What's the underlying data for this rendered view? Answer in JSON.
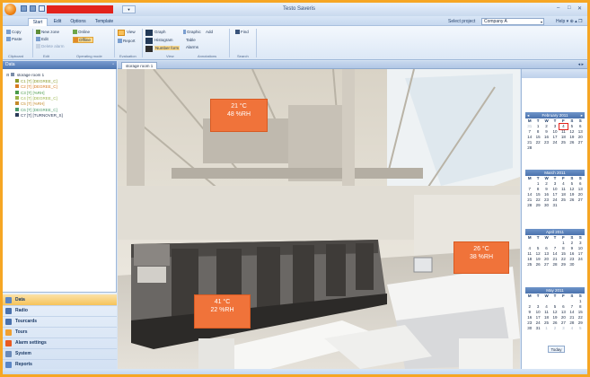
{
  "window": {
    "title": "Testo Saveris",
    "minimize_glyph": "–",
    "maximize_glyph": "□",
    "close_glyph": "✕",
    "qat_tab_label": "▼"
  },
  "ribbon_tabs": [
    "Start",
    "Edit",
    "Options",
    "Template"
  ],
  "project": {
    "label": "Select project",
    "value": "Company A",
    "arrow": "▾",
    "help": "Help ▾  ⊕ ▴ ❐"
  },
  "ribbon": {
    "clipboard": {
      "copy": "Copy",
      "paste": "Paste",
      "group": "Clipboard"
    },
    "edit": {
      "new_zone": "New zone",
      "edit": "Edit",
      "delete_alarm": "Delete alarm",
      "group": "Edit"
    },
    "operating_mode": {
      "online": "Online",
      "offline": "Offline",
      "group": "Operating mode"
    },
    "evaluation": {
      "view": "View",
      "report": "Report",
      "group": "Evaluation"
    },
    "view": {
      "graph": "Graph",
      "histogram": "Histogram",
      "number_form": "Number form",
      "group": "View"
    },
    "annotations": {
      "graphic": "Graphic",
      "table": "Table",
      "alarms": "Alarms",
      "add": "Add",
      "group": "Annotations"
    },
    "search": {
      "find": "Find",
      "group": "Search"
    }
  },
  "left_panel": {
    "title": "Data",
    "pin": "▫",
    "tree": {
      "root": "storage room 1",
      "children": [
        {
          "label": "C1 [T] [DEGREE_C]",
          "color": "#8a9a2a"
        },
        {
          "label": "C2 [T] [DEGREE_C]",
          "color": "#d97a20"
        },
        {
          "label": "C3 [T] [%RH]",
          "color": "#4a9a4a"
        },
        {
          "label": "C4 [T] [DEGREE_C]",
          "color": "#9ab44a"
        },
        {
          "label": "C5 [T] [%RH]",
          "color": "#c48a2a"
        },
        {
          "label": "C6 [T] [DEGREE_C]",
          "color": "#4a9a6a"
        },
        {
          "label": "C7 [T] [TURNOVER_S]",
          "color": "#2a3a58"
        }
      ]
    }
  },
  "nav": [
    {
      "label": "Data",
      "icon": "data-icon",
      "color": "#5b86c5",
      "active": true
    },
    {
      "label": "Radio",
      "icon": "radio-icon",
      "color": "#4a72ad"
    },
    {
      "label": "Tourcards",
      "icon": "tourcards-icon",
      "color": "#4a72ad"
    },
    {
      "label": "Tours",
      "icon": "tours-icon",
      "color": "#f0a030"
    },
    {
      "label": "Alarm settings",
      "icon": "alarm-icon",
      "color": "#e85a20"
    },
    {
      "label": "System",
      "icon": "system-icon",
      "color": "#6a8ab8"
    },
    {
      "label": "Reports",
      "icon": "reports-icon",
      "color": "#5b86c5"
    }
  ],
  "view_tab": {
    "label": "storage room 1",
    "close": "◂ ▸"
  },
  "readouts": [
    {
      "temp": "21 °C",
      "rh": "48 %RH"
    },
    {
      "temp": "26 °C",
      "rh": "38 %RH"
    },
    {
      "temp": "41 °C",
      "rh": "22 %RH"
    }
  ],
  "calendar": {
    "day_names": [
      "M",
      "T",
      "W",
      "T",
      "F",
      "S",
      "S"
    ],
    "today_label": "Today",
    "months": [
      {
        "title": "February 2011",
        "prev": "◂",
        "next": "▸",
        "days": [
          "31",
          "1",
          "2",
          "3",
          "4",
          "5",
          "6",
          "7",
          "8",
          "9",
          "10",
          "11",
          "12",
          "13",
          "14",
          "15",
          "16",
          "17",
          "18",
          "19",
          "20",
          "21",
          "22",
          "23",
          "24",
          "25",
          "26",
          "27",
          "28"
        ],
        "lead_other_month": 1,
        "today_index": 4
      },
      {
        "title": "March 2011",
        "days": [
          "1",
          "2",
          "3",
          "4",
          "5",
          "6",
          "7",
          "8",
          "9",
          "10",
          "11",
          "12",
          "13",
          "14",
          "15",
          "16",
          "17",
          "18",
          "19",
          "20",
          "21",
          "22",
          "23",
          "24",
          "25",
          "26",
          "27",
          "28",
          "29",
          "30",
          "31"
        ],
        "lead_blank": 1
      },
      {
        "title": "April 2011",
        "days": [
          "1",
          "2",
          "3",
          "4",
          "5",
          "6",
          "7",
          "8",
          "9",
          "10",
          "11",
          "12",
          "13",
          "14",
          "15",
          "16",
          "17",
          "18",
          "19",
          "20",
          "21",
          "22",
          "23",
          "24",
          "25",
          "26",
          "27",
          "28",
          "29",
          "30"
        ],
        "lead_blank": 4
      },
      {
        "title": "May 2011",
        "days": [
          "1",
          "2",
          "3",
          "4",
          "5",
          "6",
          "7",
          "8",
          "9",
          "10",
          "11",
          "12",
          "13",
          "14",
          "15",
          "16",
          "17",
          "18",
          "19",
          "20",
          "21",
          "22",
          "23",
          "24",
          "25",
          "26",
          "27",
          "28",
          "29",
          "30",
          "31",
          "1",
          "2",
          "3",
          "4",
          "5"
        ],
        "lead_blank": 6,
        "trail_other_month": 5
      }
    ]
  }
}
